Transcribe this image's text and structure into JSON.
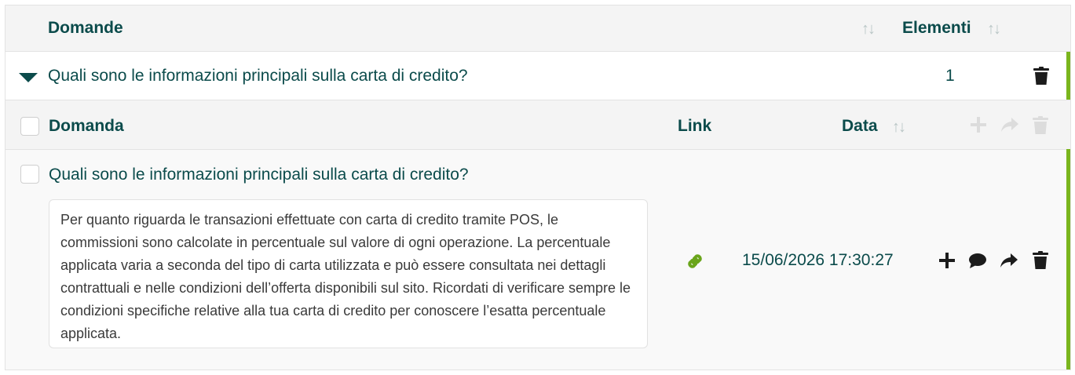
{
  "header": {
    "domande_label": "Domande",
    "elementi_label": "Elementi",
    "sort_glyph": "↑↓"
  },
  "parent_row": {
    "question": "Quali sono le informazioni principali sulla carta di credito?",
    "count": "1"
  },
  "sub_header": {
    "domanda_label": "Domanda",
    "link_label": "Link",
    "data_label": "Data",
    "sort_glyph": "↑↓"
  },
  "sub_row": {
    "question": "Quali sono le informazioni principali sulla carta di credito?",
    "answer": "Per quanto riguarda le transazioni effettuate con carta di credito tramite POS, le commissioni sono calcolate in percentuale sul valore di ogni operazione. La percentuale applicata varia a seconda del tipo di carta utilizzata e può essere consultata nei dettagli contrattuali e nelle condizioni dell’offerta disponibili sul sito. Ricordati di verificare sempre le condizioni specifiche relative alla tua carta di credito per conoscere l’esatta percentuale applicata.",
    "date": "15/06/2026 17:30:27"
  },
  "icons": {
    "expand": "caret-down-icon",
    "delete": "trash-icon",
    "add": "plus-icon",
    "comment": "comment-icon",
    "share": "share-icon",
    "link": "link-icon"
  },
  "colors": {
    "text": "#0b4b4b",
    "accent_green": "#7ab51d",
    "link_green": "#6aa51b",
    "header_bg": "#f4f4f4",
    "disabled_icon": "#dcdcdc"
  }
}
